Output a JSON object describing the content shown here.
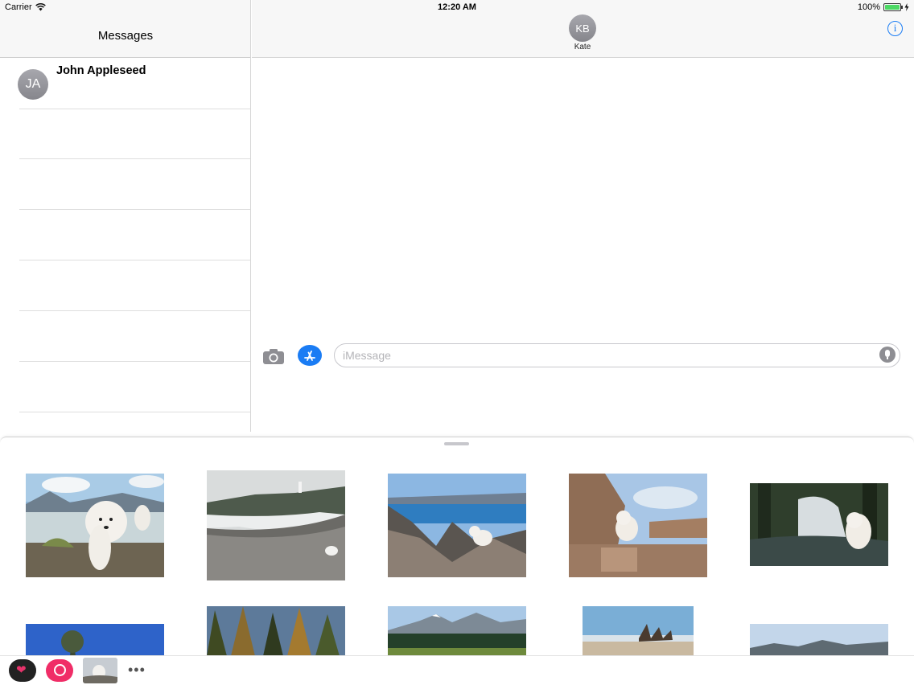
{
  "status_bar": {
    "carrier": "Carrier",
    "time": "12:20 AM",
    "battery": "100%"
  },
  "sidebar": {
    "title": "Messages",
    "conversations": [
      {
        "initials": "JA",
        "name": "John Appleseed"
      }
    ]
  },
  "conversation": {
    "contact_initials": "KB",
    "contact_name": "Kate",
    "input_placeholder": "iMessage"
  },
  "drawer": {
    "photos": [
      {
        "scene": "white dog by lake with mountains"
      },
      {
        "scene": "pebble beach with lighthouse"
      },
      {
        "scene": "dog on rocky summit above blue lake"
      },
      {
        "scene": "dog on stone wall in canyon"
      },
      {
        "scene": "dog by forest waterfall"
      },
      {
        "scene": "pine tree under blue sky"
      },
      {
        "scene": "autumn forest"
      },
      {
        "scene": "mountain range over evergreen forest"
      },
      {
        "scene": "shipwreck on beach"
      },
      {
        "scene": "hills under pale sky"
      }
    ]
  },
  "app_strip": {
    "apps": [
      {
        "icon": "heart-sticker-icon"
      },
      {
        "icon": "search-gif-icon"
      },
      {
        "icon": "photo-app-icon"
      },
      {
        "icon": "more-icon"
      }
    ]
  },
  "colors": {
    "accent": "#1a7cf4",
    "avatar": "#98989e",
    "search_app": "#f02d67"
  }
}
